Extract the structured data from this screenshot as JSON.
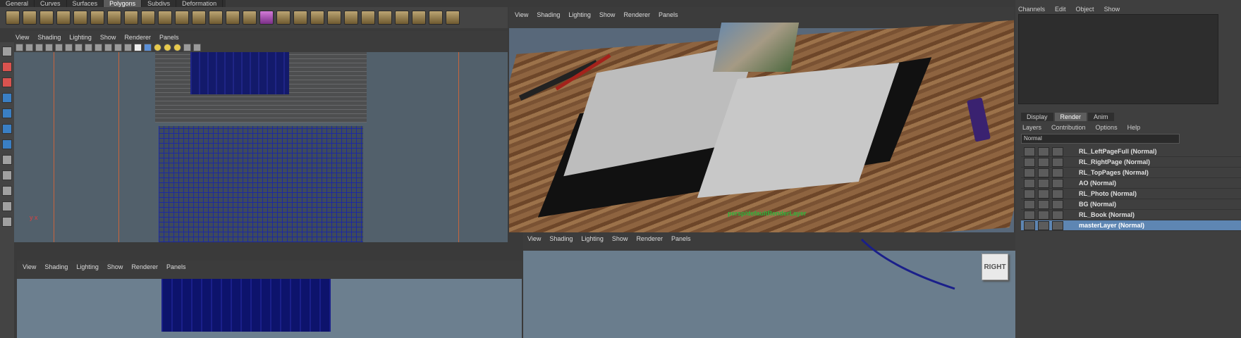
{
  "shelf": {
    "tabs": [
      "General",
      "Curves",
      "Surfaces",
      "Polygons",
      "Subdivs",
      "Deformation"
    ],
    "active_tab": "Polygons"
  },
  "viewport_menu": [
    "View",
    "Shading",
    "Lighting",
    "Show",
    "Renderer",
    "Panels"
  ],
  "viewports": {
    "top_left": {
      "axis_label": "y  x"
    },
    "persp": {
      "render_label": "persp/defaultRenderLayer"
    },
    "side": {
      "view_cube_label": "RIGHT"
    }
  },
  "right_panel": {
    "channel_menu": [
      "Channels",
      "Edit",
      "Object",
      "Show"
    ],
    "layer_tabs": [
      "Display",
      "Render",
      "Anim"
    ],
    "active_layer_tab": "Render",
    "layer_menu": [
      "Layers",
      "Contribution",
      "Options",
      "Help"
    ],
    "blend_mode": "Normal",
    "layers": [
      {
        "name": "RL_LeftPageFull (Normal)",
        "selected": false
      },
      {
        "name": "RL_RightPage (Normal)",
        "selected": false
      },
      {
        "name": "RL_TopPages (Normal)",
        "selected": false
      },
      {
        "name": "AO (Normal)",
        "selected": false
      },
      {
        "name": "RL_Photo (Normal)",
        "selected": false
      },
      {
        "name": "BG (Normal)",
        "selected": false
      },
      {
        "name": "RL_Book (Normal)",
        "selected": false
      },
      {
        "name": "masterLayer (Normal)",
        "selected": true
      }
    ]
  }
}
